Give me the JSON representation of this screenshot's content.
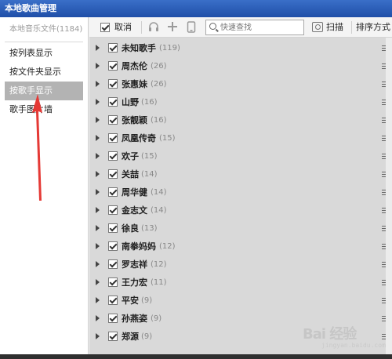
{
  "window": {
    "title": "本地歌曲管理"
  },
  "sidebar": {
    "header": "本地音乐文件(1184)",
    "items": [
      {
        "label": "按列表显示"
      },
      {
        "label": "按文件夹显示"
      },
      {
        "label": "按歌手显示"
      },
      {
        "label": "歌手图片墙"
      }
    ],
    "active_index": 2
  },
  "toolbar": {
    "cancel_label": "取消",
    "search_placeholder": "快速查找",
    "scan_label": "扫描",
    "sort_label": "排序方式",
    "icons": [
      "headphones-icon",
      "plus-icon",
      "phone-icon"
    ]
  },
  "artists": [
    {
      "name": "未知歌手",
      "count": "(119)"
    },
    {
      "name": "周杰伦",
      "count": "(26)"
    },
    {
      "name": "张惠妹",
      "count": "(26)"
    },
    {
      "name": "山野",
      "count": "(16)"
    },
    {
      "name": "张靓颖",
      "count": "(16)"
    },
    {
      "name": "凤凰传奇",
      "count": "(15)"
    },
    {
      "name": "欢子",
      "count": "(15)"
    },
    {
      "name": "关喆",
      "count": "(14)"
    },
    {
      "name": "周华健",
      "count": "(14)"
    },
    {
      "name": "金志文",
      "count": "(14)"
    },
    {
      "name": "徐良",
      "count": "(13)"
    },
    {
      "name": "南拳妈妈",
      "count": "(12)"
    },
    {
      "name": "罗志祥",
      "count": "(12)"
    },
    {
      "name": "王力宏",
      "count": "(11)"
    },
    {
      "name": "平安",
      "count": "(9)"
    },
    {
      "name": "孙燕姿",
      "count": "(9)"
    },
    {
      "name": "郑源",
      "count": "(9)"
    }
  ],
  "watermark": {
    "text": "Bai 经验",
    "sub": "jingyan.baidu.com"
  },
  "colors": {
    "titlebar": "#2a5bb8",
    "list_bg": "#d9d9d9",
    "active_item": "#b3b3b3",
    "arrow": "#e53935"
  }
}
